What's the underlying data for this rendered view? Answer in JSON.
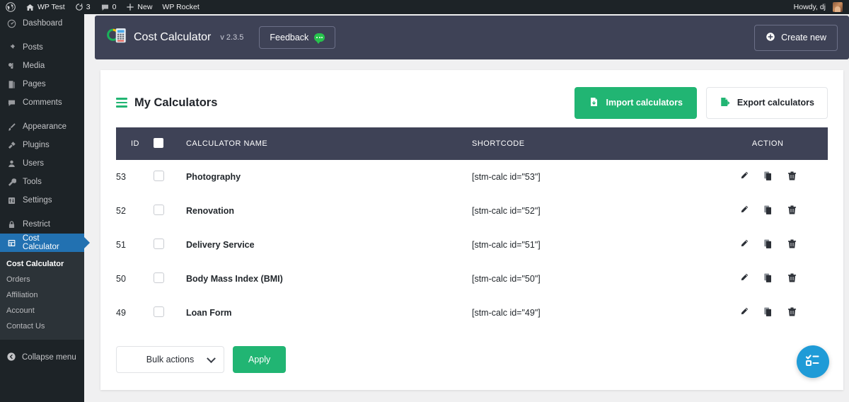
{
  "adminbar": {
    "left_items": [
      {
        "label": "",
        "icon": "wordpress-icon"
      },
      {
        "label": "WP Test",
        "icon": "home-icon"
      },
      {
        "label": "3",
        "icon": "updates-icon"
      },
      {
        "label": "0",
        "icon": "comments-icon"
      },
      {
        "label": "New",
        "icon": "plus-icon"
      },
      {
        "label": "WP Rocket",
        "icon": "rocket-icon"
      }
    ],
    "howdy": "Howdy, dj"
  },
  "sidebar": {
    "items": [
      {
        "label": "Dashboard",
        "icon": "dashboard-icon"
      },
      {
        "label": "Posts",
        "icon": "pin-icon"
      },
      {
        "label": "Media",
        "icon": "media-icon"
      },
      {
        "label": "Pages",
        "icon": "pages-icon"
      },
      {
        "label": "Comments",
        "icon": "comments-icon"
      },
      {
        "label": "Appearance",
        "icon": "brush-icon"
      },
      {
        "label": "Plugins",
        "icon": "plug-icon"
      },
      {
        "label": "Users",
        "icon": "user-icon"
      },
      {
        "label": "Tools",
        "icon": "wrench-icon"
      },
      {
        "label": "Settings",
        "icon": "settings-icon"
      },
      {
        "label": "Restrict",
        "icon": "lock-icon"
      },
      {
        "label": "Cost Calculator",
        "icon": "calculator-menu-icon"
      }
    ],
    "submenu": [
      {
        "label": "Cost Calculator",
        "active": true
      },
      {
        "label": "Orders",
        "active": false
      },
      {
        "label": "Affiliation",
        "active": false
      },
      {
        "label": "Account",
        "active": false
      },
      {
        "label": "Contact Us",
        "active": false
      }
    ],
    "collapse_label": "Collapse menu",
    "active_color": "#2271b1"
  },
  "plugin_header": {
    "title": "Cost Calculator",
    "version": "v 2.3.5",
    "feedback_label": "Feedback",
    "create_new_label": "Create new",
    "background": "#3e4256"
  },
  "page": {
    "title": "My Calculators",
    "import_label": "Import calculators",
    "export_label": "Export calculators",
    "accent_green": "#21b573"
  },
  "table": {
    "headers": {
      "id": "ID",
      "name": "CALCULATOR NAME",
      "shortcode": "SHORTCODE",
      "action": "ACTION"
    },
    "rows": [
      {
        "id": "53",
        "name": "Photography",
        "shortcode": "[stm-calc id=\"53\"]"
      },
      {
        "id": "52",
        "name": "Renovation",
        "shortcode": "[stm-calc id=\"52\"]"
      },
      {
        "id": "51",
        "name": "Delivery Service",
        "shortcode": "[stm-calc id=\"51\"]"
      },
      {
        "id": "50",
        "name": "Body Mass Index (BMI)",
        "shortcode": "[stm-calc id=\"50\"]"
      },
      {
        "id": "49",
        "name": "Loan Form",
        "shortcode": "[stm-calc id=\"49\"]"
      }
    ],
    "actions": [
      "edit-icon",
      "duplicate-icon",
      "delete-icon"
    ]
  },
  "footer": {
    "bulk_actions_label": "Bulk actions",
    "apply_label": "Apply"
  },
  "fab": {
    "icon": "checklist-icon",
    "color": "#1f9bd7"
  }
}
